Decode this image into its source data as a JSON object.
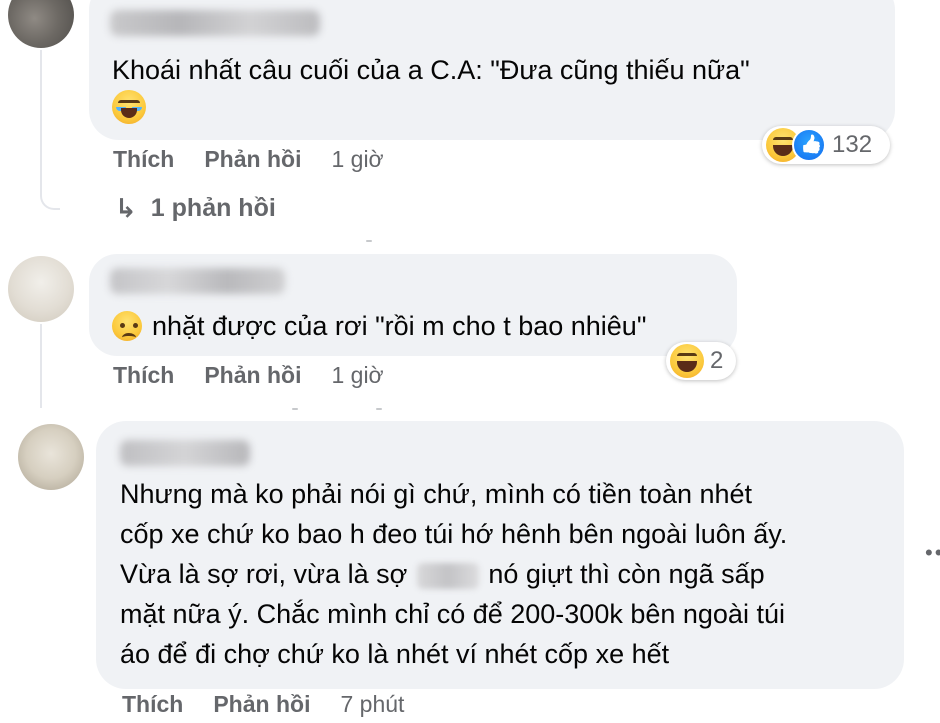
{
  "comments": [
    {
      "text": "Khoái nhất câu cuối của a C.A: \"Đưa cũng thiếu nữa\"",
      "inline_emoji": "rolling-laughing",
      "actions": {
        "like": "Thích",
        "reply": "Phản hồi",
        "time": "1 giờ"
      },
      "reactions": {
        "icons": [
          "haha",
          "like"
        ],
        "count": "132"
      },
      "replies_link": "1 phản hồi"
    },
    {
      "text": "nhặt được của rơi \"rồi m cho t bao nhiêu\"",
      "leading_emoji": "sad-tear",
      "actions": {
        "like": "Thích",
        "reply": "Phản hồi",
        "time": "1 giờ"
      },
      "reactions": {
        "icons": [
          "haha"
        ],
        "count": "2"
      }
    },
    {
      "lines": [
        "Nhưng mà ko phải nói gì chứ, mình có tiền toàn nhét",
        "cốp xe chứ ko bao h đeo túi hớ hênh bên ngoài luôn ấy.",
        "Vừa là sợ rơi, vừa là sợ",
        "nó giựt thì còn ngã sấp",
        "mặt nữa ý. Chắc mình chỉ có để 200-300k bên ngoài túi",
        "áo để đi chợ chứ ko là nhét ví nhét cốp xe hết"
      ],
      "actions": {
        "like": "Thích",
        "reply": "Phản hồi",
        "time": "7 phút"
      }
    }
  ],
  "icons": {
    "reply_arrow": "↳",
    "more": "••"
  },
  "colors": {
    "bubble": "#f0f2f5",
    "secondary_text": "#65676b",
    "like_blue": "#1877f2"
  }
}
